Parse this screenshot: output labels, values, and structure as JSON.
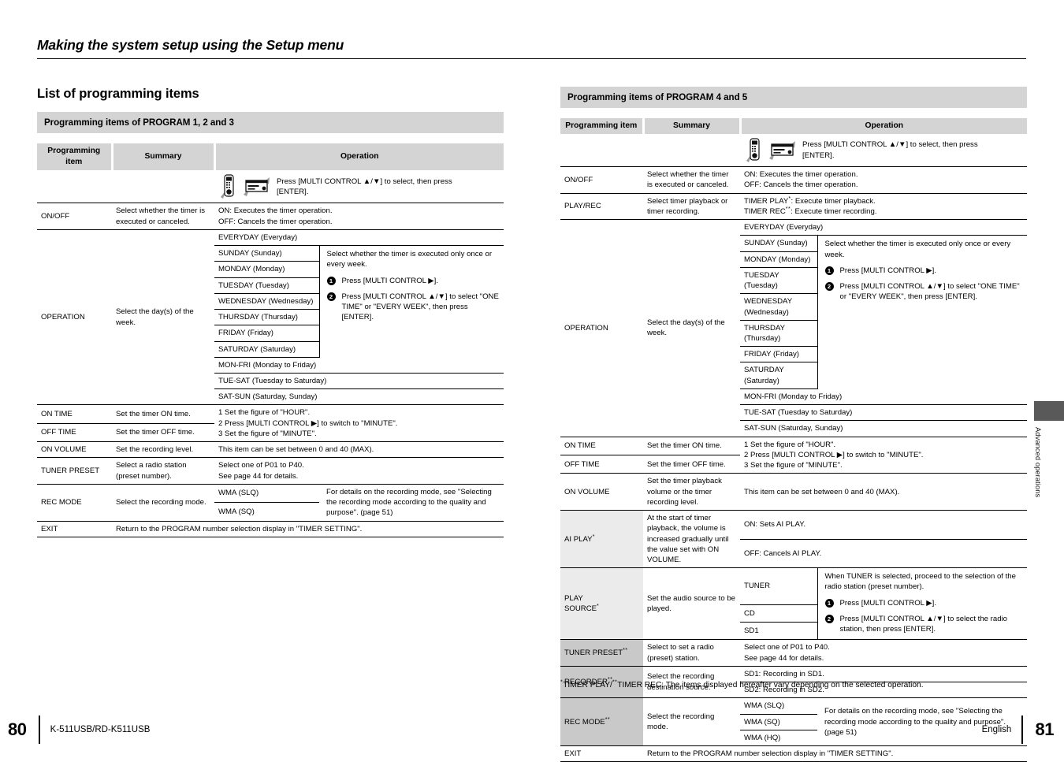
{
  "running_head": "Making the system setup using the Setup menu",
  "left_page": {
    "section_title": "List of programming items",
    "band": "Programming items of PROGRAM 1, 2 and 3",
    "columns": {
      "item": "Programming item",
      "summary": "Summary",
      "operation": "Operation"
    },
    "icon_row": {
      "icons": [
        "remote-control-icon",
        "stereo-receiver-icon"
      ],
      "text_line1": "Press [MULTI CONTROL ▲/▼] to select, then press",
      "text_line2": "[ENTER]."
    },
    "rows": {
      "onoff": {
        "item": "ON/OFF",
        "summary": "Select whether the timer is executed or canceled.",
        "op_line1": "ON: Executes the timer operation.",
        "op_line2": "OFF: Cancels the timer operation."
      },
      "operation": {
        "item": "OPERATION",
        "summary": "Select the day(s) of the week.",
        "everyday": "EVERYDAY (Everyday)",
        "days": [
          "SUNDAY (Sunday)",
          "MONDAY (Monday)",
          "TUESDAY (Tuesday)",
          "WEDNESDAY (Wednesday)",
          "THURSDAY (Thursday)",
          "FRIDAY (Friday)",
          "SATURDAY (Saturday)"
        ],
        "ranges": [
          "MON-FRI (Monday to Friday)",
          "TUE-SAT (Tuesday to Saturday)",
          "SAT-SUN (Saturday, Sunday)"
        ],
        "note_intro": "Select whether the timer is executed only once or every week.",
        "step1_num": "1",
        "step1": "Press [MULTI CONTROL ▶].",
        "step2_num": "2",
        "step2": "Press [MULTI CONTROL ▲/▼] to select \"ONE TIME\" or \"EVERY WEEK\", then press [ENTER]."
      },
      "on_time": {
        "item": "ON TIME",
        "summary": "Set the timer ON time."
      },
      "off_time": {
        "item": "OFF TIME",
        "summary": "Set the timer OFF time."
      },
      "time_op": {
        "l1": "1 Set the figure of \"HOUR\".",
        "l2": "2 Press [MULTI CONTROL ▶] to switch to \"MINUTE\".",
        "l3": "3 Set the figure of \"MINUTE\"."
      },
      "on_volume": {
        "item": "ON VOLUME",
        "summary": "Set the recording level.",
        "op": "This item can be set between 0 and 40 (MAX)."
      },
      "tuner_preset": {
        "item": "TUNER PRESET",
        "summary": "Select a radio station (preset number).",
        "op_line1": "Select one of P01 to P40.",
        "op_line2": "See page 44 for details."
      },
      "rec_mode": {
        "item": "REC MODE",
        "summary": "Select the recording mode.",
        "modes": [
          "WMA (SLQ)",
          "WMA (SQ)"
        ],
        "note": "For details on the recording mode, see \"Selecting the recording mode according to the quality and purpose\". (page 51)"
      },
      "exit": {
        "item": "EXIT",
        "op": "Return to the PROGRAM number selection display in \"TIMER SETTING\"."
      }
    }
  },
  "right_page": {
    "band": "Programming items of PROGRAM 4 and 5",
    "columns": {
      "item": "Programming item",
      "summary": "Summary",
      "operation": "Operation"
    },
    "icon_row": {
      "icons": [
        "remote-control-icon",
        "stereo-receiver-icon"
      ],
      "text_line1": "Press [MULTI CONTROL ▲/▼] to select, then press",
      "text_line2": "[ENTER]."
    },
    "rows": {
      "onoff": {
        "item": "ON/OFF",
        "summary": "Select whether the timer is executed or canceled.",
        "op_line1": "ON: Executes the timer operation.",
        "op_line2": "OFF: Cancels the timer operation."
      },
      "play_rec": {
        "item": "PLAY/REC",
        "summary": "Select timer playback or timer recording.",
        "op_line1_a": "TIMER PLAY",
        "op_line1_sup": "*",
        "op_line1_b": ": Execute timer playback.",
        "op_line2_a": "TIMER REC",
        "op_line2_sup": "**",
        "op_line2_b": ": Execute timer recording."
      },
      "operation": {
        "item": "OPERATION",
        "summary": "Select the day(s) of the week.",
        "everyday": "EVERYDAY (Everyday)",
        "days": [
          "SUNDAY (Sunday)",
          "MONDAY (Monday)",
          "TUESDAY (Tuesday)",
          "WEDNESDAY (Wednesday)",
          "THURSDAY (Thursday)",
          "FRIDAY (Friday)",
          "SATURDAY (Saturday)"
        ],
        "ranges": [
          "MON-FRI (Monday to Friday)",
          "TUE-SAT (Tuesday to Saturday)",
          "SAT-SUN (Saturday, Sunday)"
        ],
        "note_intro": "Select whether the timer is executed only once or every week.",
        "step1_num": "1",
        "step1": "Press [MULTI CONTROL ▶].",
        "step2_num": "2",
        "step2": "Press [MULTI CONTROL ▲/▼] to select \"ONE TIME\" or \"EVERY WEEK\", then press [ENTER]."
      },
      "on_time": {
        "item": "ON TIME",
        "summary": "Set the timer ON time."
      },
      "off_time": {
        "item": "OFF TIME",
        "summary": "Set the timer OFF time."
      },
      "time_op": {
        "l1": "1 Set the figure of \"HOUR\".",
        "l2": "2 Press [MULTI CONTROL ▶] to switch to \"MINUTE\".",
        "l3": "3 Set the figure of \"MINUTE\"."
      },
      "on_volume": {
        "item": "ON VOLUME",
        "summary": "Set the timer playback volume or the timer recording level.",
        "op": "This item can be set between 0 and 40 (MAX)."
      },
      "ai_play": {
        "item": "AI PLAY",
        "sup": "*",
        "summary": "At the start of timer playback, the volume is increased gradually until the value set with ON VOLUME.",
        "op_on": "ON: Sets AI PLAY.",
        "op_off": "OFF: Cancels AI PLAY."
      },
      "play_source": {
        "item_line1": "PLAY",
        "item_line2": "SOURCE",
        "sup": "*",
        "summary": "Set the audio source to be played.",
        "sources": [
          "TUNER",
          "CD",
          "SD1"
        ],
        "note_intro": "When TUNER is selected, proceed to the selection of the radio station (preset number).",
        "step1_num": "1",
        "step1": "Press [MULTI CONTROL ▶].",
        "step2_num": "2",
        "step2": "Press [MULTI CONTROL ▲/▼] to select the radio station, then press [ENTER]."
      },
      "tuner_preset": {
        "item": "TUNER PRESET",
        "sup": "**",
        "summary": "Select to set a radio (preset) station.",
        "op_line1": "Select one of P01 to P40.",
        "op_line2": "See page 44 for details."
      },
      "recorder": {
        "item": "RECORDER",
        "sup": "**",
        "summary": "Select the recording destination source.",
        "op_line1": "SD1: Recording in SD1.",
        "op_line2": "SD2: Recording in SD2."
      },
      "rec_mode": {
        "item": "REC MODE",
        "sup": "**",
        "summary": "Select the recording mode.",
        "modes": [
          "WMA (SLQ)",
          "WMA (SQ)",
          "WMA (HQ)"
        ],
        "note": "For details on the recording mode, see \"Selecting the recording mode according to the quality and purpose\". (page 51)"
      },
      "exit": {
        "item": "EXIT",
        "op": "Return to the PROGRAM number selection display in \"TIMER SETTING\"."
      }
    },
    "footnote": {
      "sup1": "*",
      "part1": "TIMER PLAY/",
      "sup2": "**",
      "part2": "TIMER REC: The items displayed hereafter vary depending on the selected operation."
    }
  },
  "side_tab": {
    "label": "Advanced operations",
    "color": "#595959"
  },
  "footer": {
    "left_page_number": "80",
    "model": "K-511USB/RD-K511USB",
    "language": "English",
    "right_page_number": "81"
  }
}
